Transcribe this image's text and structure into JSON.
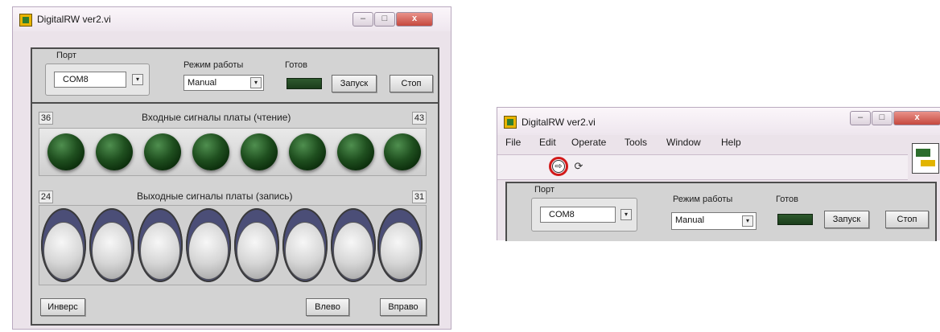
{
  "app_title": "DigitalRW ver2.vi",
  "window_controls": {
    "minimize": "–",
    "maximize": "□",
    "close": "x"
  },
  "port": {
    "label": "Порт",
    "value": "COM8"
  },
  "mode": {
    "label": "Режим работы",
    "value": "Manual"
  },
  "ready": {
    "label": "Готов"
  },
  "buttons": {
    "start": "Запуск",
    "stop": "Стоп"
  },
  "inputs_group": {
    "title": "Входные сигналы платы (чтение)",
    "start_index": "36",
    "end_index": "43",
    "led_count": 8
  },
  "outputs_group": {
    "title": "Выходные сигналы платы (запись)",
    "start_index": "24",
    "end_index": "31",
    "switch_count": 8
  },
  "bottom_buttons": {
    "invert": "Инверс",
    "left": "Влево",
    "right": "Вправо"
  },
  "menu": [
    "File",
    "Edit",
    "Operate",
    "Tools",
    "Window",
    "Help"
  ]
}
